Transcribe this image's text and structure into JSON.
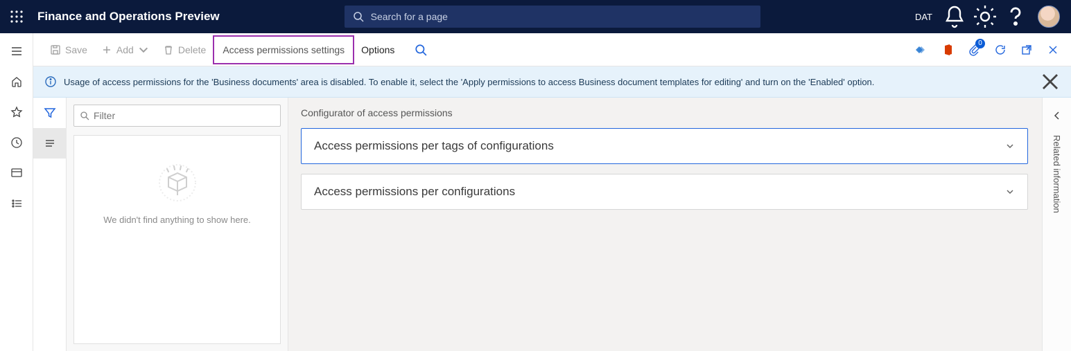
{
  "header": {
    "app_title": "Finance and Operations Preview",
    "search_placeholder": "Search for a page",
    "company": "DAT"
  },
  "actions": {
    "save": "Save",
    "add": "Add",
    "delete": "Delete",
    "access_permissions_settings": "Access permissions settings",
    "options": "Options"
  },
  "attachments": {
    "count": "0"
  },
  "banner": {
    "message": "Usage of access permissions for the 'Business documents' area is disabled. To enable it, select the 'Apply permissions to access Business document templates for editing' and turn on the 'Enabled' option."
  },
  "list": {
    "filter_placeholder": "Filter",
    "empty_message": "We didn't find anything to show here."
  },
  "detail": {
    "title": "Configurator of access permissions",
    "sections": {
      "per_tags": "Access permissions per tags of configurations",
      "per_configs": "Access permissions per configurations"
    }
  },
  "right_rail": {
    "label": "Related information"
  }
}
